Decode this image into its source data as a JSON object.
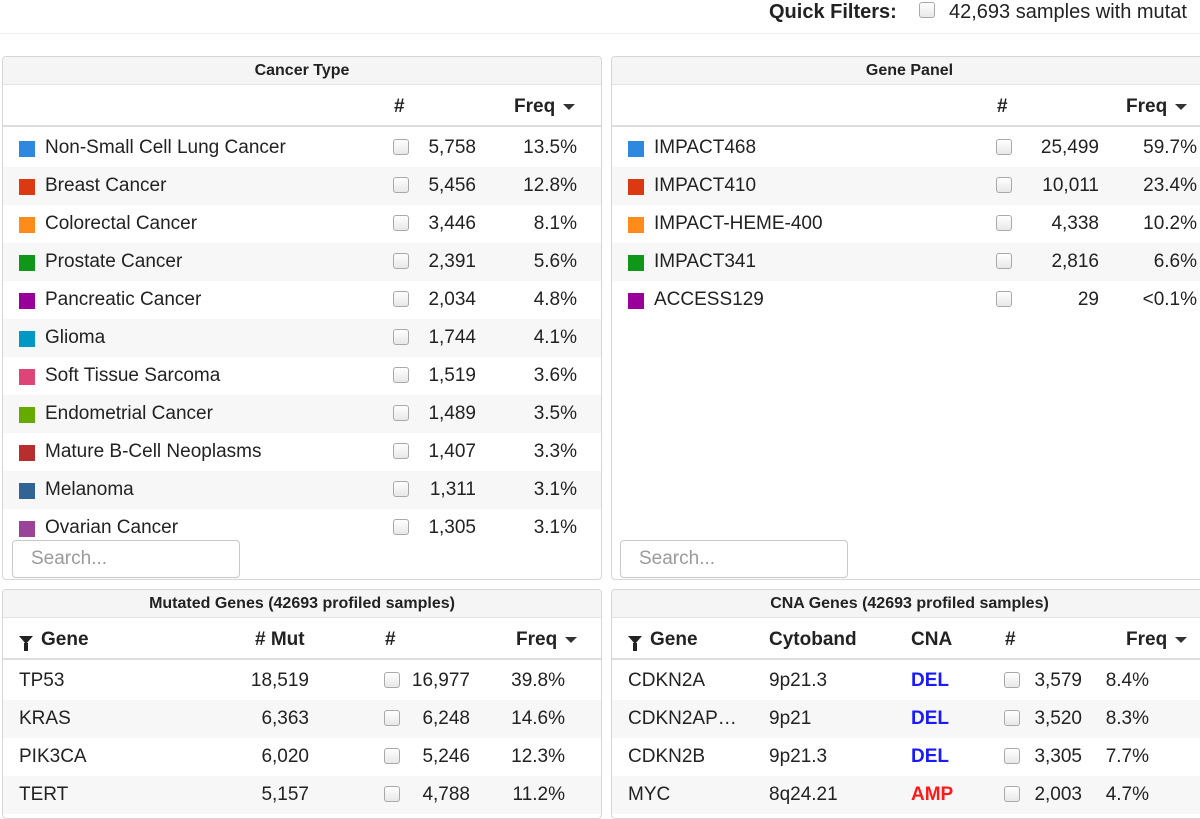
{
  "quick_filters": {
    "label": "Quick Filters:",
    "text": "42,693 samples with mutat"
  },
  "cancer_type": {
    "title": "Cancer Type",
    "headers": {
      "count": "#",
      "freq": "Freq"
    },
    "search_placeholder": "Search...",
    "rows": [
      {
        "name": "Non-Small Cell Lung Cancer",
        "count": "5,758",
        "freq": "13.5%",
        "color": "#2f88e0"
      },
      {
        "name": "Breast Cancer",
        "count": "5,456",
        "freq": "12.8%",
        "color": "#dc3912"
      },
      {
        "name": "Colorectal Cancer",
        "count": "3,446",
        "freq": "8.1%",
        "color": "#ff8c1a"
      },
      {
        "name": "Prostate Cancer",
        "count": "2,391",
        "freq": "5.6%",
        "color": "#109618"
      },
      {
        "name": "Pancreatic Cancer",
        "count": "2,034",
        "freq": "4.8%",
        "color": "#990099"
      },
      {
        "name": "Glioma",
        "count": "1,744",
        "freq": "4.1%",
        "color": "#0099c6"
      },
      {
        "name": "Soft Tissue Sarcoma",
        "count": "1,519",
        "freq": "3.6%",
        "color": "#dd4477"
      },
      {
        "name": "Endometrial Cancer",
        "count": "1,489",
        "freq": "3.5%",
        "color": "#66aa00"
      },
      {
        "name": "Mature B-Cell Neoplasms",
        "count": "1,407",
        "freq": "3.3%",
        "color": "#b82e2e"
      },
      {
        "name": "Melanoma",
        "count": "1,311",
        "freq": "3.1%",
        "color": "#316395"
      },
      {
        "name": "Ovarian Cancer",
        "count": "1,305",
        "freq": "3.1%",
        "color": "#994499"
      }
    ]
  },
  "gene_panel": {
    "title": "Gene Panel",
    "headers": {
      "count": "#",
      "freq": "Freq"
    },
    "search_placeholder": "Search...",
    "rows": [
      {
        "name": "IMPACT468",
        "count": "25,499",
        "freq": "59.7%",
        "color": "#2f88e0"
      },
      {
        "name": "IMPACT410",
        "count": "10,011",
        "freq": "23.4%",
        "color": "#dc3912"
      },
      {
        "name": "IMPACT-HEME-400",
        "count": "4,338",
        "freq": "10.2%",
        "color": "#ff8c1a"
      },
      {
        "name": "IMPACT341",
        "count": "2,816",
        "freq": "6.6%",
        "color": "#109618"
      },
      {
        "name": "ACCESS129",
        "count": "29",
        "freq": "<0.1%",
        "color": "#990099"
      }
    ]
  },
  "mutated_genes": {
    "title": "Mutated Genes (42693 profiled samples)",
    "headers": {
      "gene": "Gene",
      "mut": "# Mut",
      "count": "#",
      "freq": "Freq"
    },
    "rows": [
      {
        "gene": "TP53",
        "mut": "18,519",
        "count": "16,977",
        "freq": "39.8%"
      },
      {
        "gene": "KRAS",
        "mut": "6,363",
        "count": "6,248",
        "freq": "14.6%"
      },
      {
        "gene": "PIK3CA",
        "mut": "6,020",
        "count": "5,246",
        "freq": "12.3%"
      },
      {
        "gene": "TERT",
        "mut": "5,157",
        "count": "4,788",
        "freq": "11.2%"
      }
    ]
  },
  "cna_genes": {
    "title": "CNA Genes (42693 profiled samples)",
    "headers": {
      "gene": "Gene",
      "cytoband": "Cytoband",
      "cna": "CNA",
      "count": "#",
      "freq": "Freq"
    },
    "colors": {
      "del": "#1a1aff",
      "amp": "#ff1a1a"
    },
    "rows": [
      {
        "gene": "CDKN2A",
        "cytoband": "9p21.3",
        "cna": "DEL",
        "count": "3,579",
        "freq": "8.4%"
      },
      {
        "gene": "CDKN2AP…",
        "cytoband": "9p21",
        "cna": "DEL",
        "count": "3,520",
        "freq": "8.3%"
      },
      {
        "gene": "CDKN2B",
        "cytoband": "9p21.3",
        "cna": "DEL",
        "count": "3,305",
        "freq": "7.7%"
      },
      {
        "gene": "MYC",
        "cytoband": "8q24.21",
        "cna": "AMP",
        "count": "2,003",
        "freq": "4.7%"
      }
    ]
  }
}
